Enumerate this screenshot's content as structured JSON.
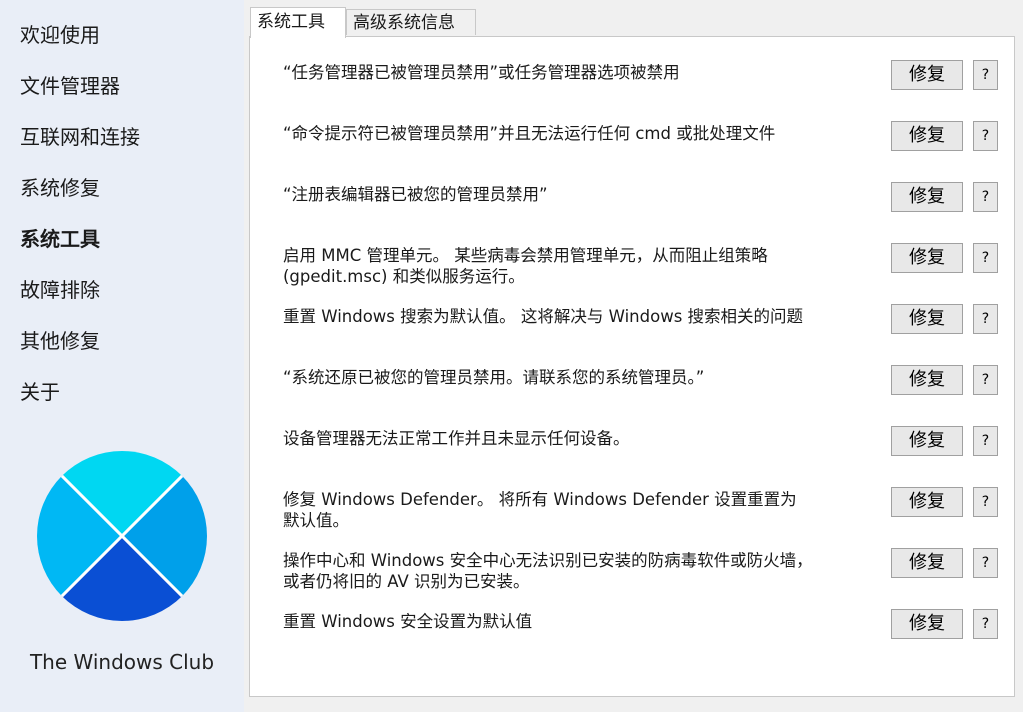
{
  "sidebar": {
    "items": [
      {
        "label": "欢迎使用",
        "active": false
      },
      {
        "label": "文件管理器",
        "active": false
      },
      {
        "label": "互联网和连接",
        "active": false
      },
      {
        "label": "系统修复",
        "active": false
      },
      {
        "label": "系统工具",
        "active": true
      },
      {
        "label": "故障排除",
        "active": false
      },
      {
        "label": "其他修复",
        "active": false
      },
      {
        "label": "关于",
        "active": false
      }
    ],
    "brand": "The Windows Club",
    "logo_colors": {
      "top": "#00d7f2",
      "left": "#00b8f4",
      "right": "#00a0ea",
      "bottom": "#0a4fd4"
    }
  },
  "tabs": [
    {
      "label": "系统工具",
      "active": true
    },
    {
      "label": "高级系统信息",
      "active": false
    }
  ],
  "fix_label": "修复",
  "help_label": "?",
  "fixes": [
    {
      "text": "“任务管理器已被管理员禁用”或任务管理器选项被禁用"
    },
    {
      "text": "“命令提示符已被管理员禁用”并且无法运行任何 cmd 或批处理文件"
    },
    {
      "text": "“注册表编辑器已被您的管理员禁用”"
    },
    {
      "text": "启用 MMC 管理单元。 某些病毒会禁用管理单元，从而阻止组策略 (gpedit.msc) 和类似服务运行。"
    },
    {
      "text": "重置 Windows 搜索为默认值。 这将解决与 Windows 搜索相关的问题"
    },
    {
      "text": "“系统还原已被您的管理员禁用。请联系您的系统管理员。”"
    },
    {
      "text": "设备管理器无法正常工作并且未显示任何设备。"
    },
    {
      "text": "修复 Windows Defender。 将所有 Windows Defender 设置重置为默认值。"
    },
    {
      "text": "操作中心和 Windows 安全中心无法识别已安装的防病毒软件或防火墙，或者仍将旧的 AV 识别为已安装。"
    },
    {
      "text": "重置 Windows 安全设置为默认值"
    }
  ]
}
